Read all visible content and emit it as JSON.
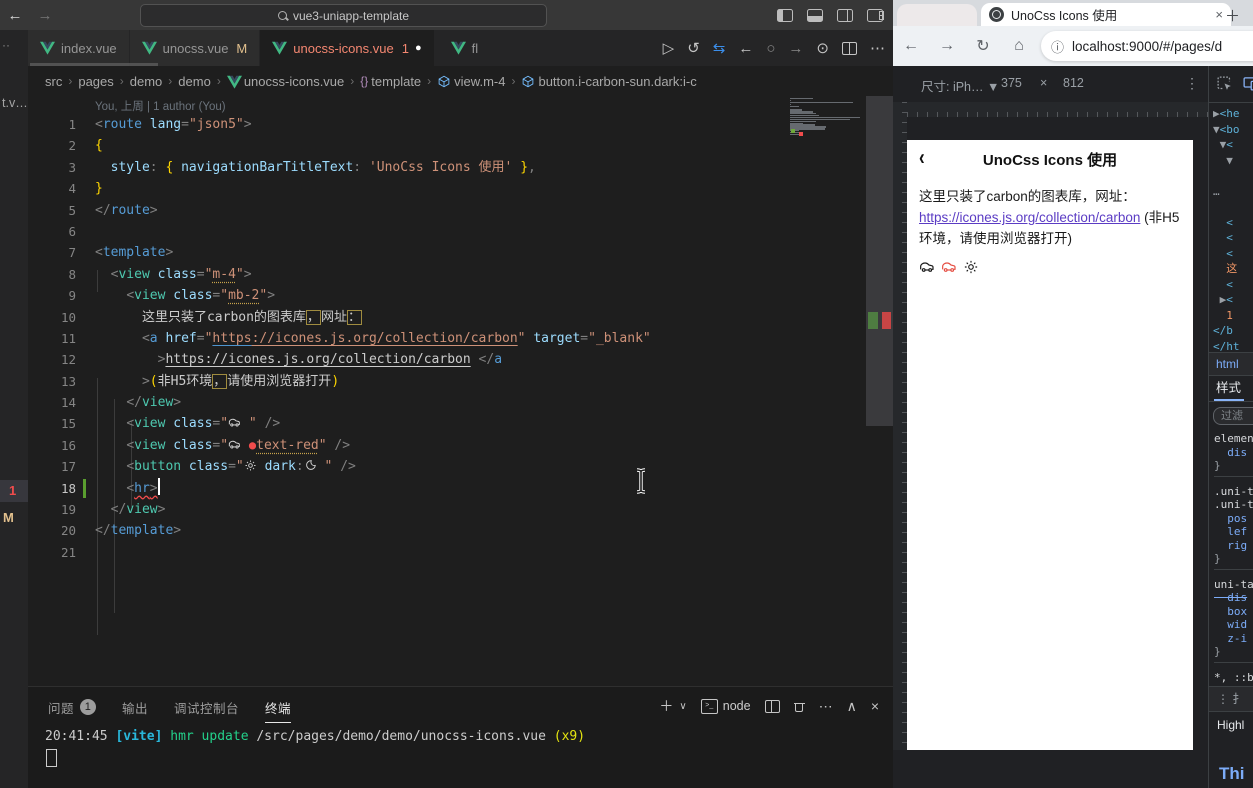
{
  "colors": {
    "vue_green": "#41b883",
    "error_red": "#f14c4c",
    "modified_gold": "#e2c08d",
    "tab_red": "#f48771",
    "accent_blue": "#569cd6",
    "string_orange": "#ce9178",
    "link_purple": "#5b3cc4",
    "devtools_blue": "#8ab4f8"
  },
  "vscode": {
    "titlebar": {
      "search": "vue3-uniapp-template"
    },
    "window_icons": [
      "panel-left",
      "panel-bottom",
      "panel-right",
      "customize-layout"
    ],
    "left_strip": {
      "overflow": "··",
      "file": "t.v…",
      "badge_error": "1",
      "badge_modified": "M"
    },
    "tabs": [
      {
        "label": "index.vue",
        "cls": ""
      },
      {
        "label": "unocss.vue",
        "badge": "M",
        "cls": "t-gold"
      },
      {
        "label": "unocss-icons.vue",
        "badge": "1",
        "dot": "●",
        "cls": "t-red",
        "active": true
      },
      {
        "label": "fl",
        "cls": "",
        "stub": true
      }
    ],
    "editor_actions": [
      {
        "g": "▷",
        "c": ""
      },
      {
        "g": "↺",
        "c": ""
      },
      {
        "g": "⇆",
        "c": "#3b8eea"
      },
      {
        "g": "←",
        "c": ""
      },
      {
        "g": "○",
        "c": "#8a8a8a"
      },
      {
        "g": "→",
        "c": "#8a8a8a"
      },
      {
        "g": "⊙",
        "c": ""
      },
      {
        "g": "SPLIT",
        "c": ""
      },
      {
        "g": "⋯",
        "c": ""
      }
    ],
    "breadcrumb": [
      {
        "t": "src"
      },
      {
        "t": "pages"
      },
      {
        "t": "demo"
      },
      {
        "t": "demo"
      },
      {
        "t": "unocss-icons.vue",
        "ic": "vue"
      },
      {
        "t": "template",
        "ic": "braces"
      },
      {
        "t": "view.m-4",
        "ic": "cube"
      },
      {
        "t": "button.i-carbon-sun.dark:i-c",
        "ic": "cube"
      }
    ],
    "blame": "You, 上周 | 1 author (You)",
    "lines": [
      {
        "n": 1,
        "s": [
          [
            "p",
            "<"
          ],
          [
            "tag",
            "route"
          ],
          [
            "attr",
            " lang"
          ],
          [
            "p",
            "="
          ],
          [
            "str",
            "\"json5\""
          ],
          [
            "p",
            ">"
          ]
        ]
      },
      {
        "n": 2,
        "s": [
          [
            "br",
            "{"
          ]
        ]
      },
      {
        "n": 3,
        "s": [
          [
            "txt",
            "  "
          ],
          [
            "key",
            "style"
          ],
          [
            "p",
            ":"
          ],
          [
            "txt",
            " "
          ],
          [
            "br",
            "{"
          ],
          [
            "txt",
            " "
          ],
          [
            "key",
            "navigationBarTitleText"
          ],
          [
            "p",
            ":"
          ],
          [
            "txt",
            " "
          ],
          [
            "str",
            "'UnoCss Icons 使用'"
          ],
          [
            "txt",
            " "
          ],
          [
            "br",
            "}"
          ],
          [
            "p",
            ","
          ]
        ]
      },
      {
        "n": 4,
        "s": [
          [
            "br",
            "}"
          ]
        ]
      },
      {
        "n": 5,
        "s": [
          [
            "p",
            "</"
          ],
          [
            "tag",
            "route"
          ],
          [
            "p",
            ">"
          ]
        ]
      },
      {
        "n": 6,
        "s": []
      },
      {
        "n": 7,
        "s": [
          [
            "p",
            "<"
          ],
          [
            "tag",
            "template"
          ],
          [
            "p",
            ">"
          ]
        ]
      },
      {
        "n": 8,
        "s": [
          [
            "txt",
            "  "
          ],
          [
            "p",
            "<"
          ],
          [
            "cmp",
            "view"
          ],
          [
            "attr",
            " class"
          ],
          [
            "p",
            "="
          ],
          [
            "str",
            "\""
          ],
          [
            "stru",
            "m-4"
          ],
          [
            "str",
            "\""
          ],
          [
            "p",
            ">"
          ]
        ]
      },
      {
        "n": 9,
        "s": [
          [
            "txt",
            "    "
          ],
          [
            "p",
            "<"
          ],
          [
            "cmp",
            "view"
          ],
          [
            "attr",
            " class"
          ],
          [
            "p",
            "="
          ],
          [
            "str",
            "\""
          ],
          [
            "stru",
            "mb-2"
          ],
          [
            "str",
            "\""
          ],
          [
            "p",
            ">"
          ]
        ]
      },
      {
        "n": 10,
        "s": [
          [
            "txt",
            "      这里只装了carbon的图表库"
          ],
          [
            "box",
            "，"
          ],
          [
            "txt",
            "网址"
          ],
          [
            "box",
            "："
          ]
        ]
      },
      {
        "n": 11,
        "s": [
          [
            "txt",
            "      "
          ],
          [
            "p",
            "<"
          ],
          [
            "tag",
            "a"
          ],
          [
            "attr",
            " href"
          ],
          [
            "p",
            "="
          ],
          [
            "str",
            "\""
          ],
          [
            "lnkb",
            "https"
          ],
          [
            "lnk",
            "://icones.js.org/collection/carbon"
          ],
          [
            "str",
            "\""
          ],
          [
            "attr",
            " target"
          ],
          [
            "p",
            "="
          ],
          [
            "str",
            "\"_blank\""
          ]
        ]
      },
      {
        "n": 12,
        "s": [
          [
            "txt",
            "        "
          ],
          [
            "p",
            ">"
          ],
          [
            "lnkw",
            "https://icones.js.org/collection/carbon"
          ],
          [
            "txt",
            " "
          ],
          [
            "p",
            "</"
          ],
          [
            "tag",
            "a"
          ]
        ]
      },
      {
        "n": 13,
        "s": [
          [
            "txt",
            "      "
          ],
          [
            "p",
            ">"
          ],
          [
            "br",
            "("
          ],
          [
            "txt",
            "非H5环境"
          ],
          [
            "box",
            "，"
          ],
          [
            "txt",
            "请使用浏览器打开"
          ],
          [
            "br",
            ")"
          ]
        ]
      },
      {
        "n": 14,
        "s": [
          [
            "txt",
            "    "
          ],
          [
            "p",
            "</"
          ],
          [
            "cmp",
            "view"
          ],
          [
            "p",
            ">"
          ]
        ]
      },
      {
        "n": 15,
        "s": [
          [
            "txt",
            "    "
          ],
          [
            "p",
            "<"
          ],
          [
            "cmp",
            "view"
          ],
          [
            "attr",
            " class"
          ],
          [
            "p",
            "="
          ],
          [
            "str",
            "\""
          ],
          [
            "car",
            ""
          ],
          [
            "str",
            " \""
          ],
          [
            "txt",
            " "
          ],
          [
            "p",
            "/>"
          ]
        ]
      },
      {
        "n": 16,
        "s": [
          [
            "txt",
            "    "
          ],
          [
            "p",
            "<"
          ],
          [
            "cmp",
            "view"
          ],
          [
            "attr",
            " class"
          ],
          [
            "p",
            "="
          ],
          [
            "str",
            "\""
          ],
          [
            "car",
            ""
          ],
          [
            "str",
            " "
          ],
          [
            "dot",
            "●"
          ],
          [
            "stru",
            "text-red"
          ],
          [
            "str",
            "\""
          ],
          [
            "txt",
            " "
          ],
          [
            "p",
            "/>"
          ]
        ]
      },
      {
        "n": 17,
        "s": [
          [
            "txt",
            "    "
          ],
          [
            "p",
            "<"
          ],
          [
            "cmp",
            "button"
          ],
          [
            "attr",
            " class"
          ],
          [
            "p",
            "="
          ],
          [
            "str",
            "\""
          ],
          [
            "sun",
            ""
          ],
          [
            "str",
            " "
          ],
          [
            "key",
            "dark"
          ],
          [
            "p",
            ":"
          ],
          [
            "moon",
            ""
          ],
          [
            "str",
            " \""
          ],
          [
            "txt",
            " "
          ],
          [
            "p",
            "/>"
          ]
        ]
      },
      {
        "n": 18,
        "s": [
          [
            "txt",
            "    "
          ],
          [
            "p",
            "<"
          ],
          [
            "errt",
            "hr"
          ],
          [
            "errp",
            ">"
          ],
          [
            "caret",
            ""
          ]
        ],
        "mod": true
      },
      {
        "n": 19,
        "s": [
          [
            "txt",
            "  "
          ],
          [
            "p",
            "</"
          ],
          [
            "cmp",
            "view"
          ],
          [
            "p",
            ">"
          ]
        ]
      },
      {
        "n": 20,
        "s": [
          [
            "p",
            "</"
          ],
          [
            "tag",
            "template"
          ],
          [
            "p",
            ">"
          ]
        ]
      },
      {
        "n": 21,
        "s": []
      }
    ],
    "panel": {
      "tabs": [
        {
          "t": "问题",
          "badge": "1"
        },
        {
          "t": "输出"
        },
        {
          "t": "调试控制台"
        },
        {
          "t": "终端",
          "active": true
        }
      ],
      "plus": "＋",
      "chev": "∨",
      "node_label": "node",
      "collapse": "∧",
      "close": "×",
      "more": "⋯",
      "terminal": [
        [
          "w",
          "20:41:45 "
        ],
        [
          "cy",
          "[vite]"
        ],
        [
          "w",
          " "
        ],
        [
          "gr",
          "hmr update"
        ],
        [
          "w",
          " /src/pages/demo/demo/unocss-icons.vue "
        ],
        [
          "ye",
          "(x9)"
        ]
      ]
    }
  },
  "chrome": {
    "tab": {
      "title": "UnoCss Icons 使用",
      "close": "×",
      "new": "＋"
    },
    "toolbar": {
      "back": "←",
      "forward": "→",
      "reload": "↻",
      "home": "⌂",
      "info": "ⓘ",
      "url": "localhost:9000/#/pages/d"
    },
    "device": {
      "label": "尺寸: iPh… ▼",
      "w": "375",
      "x": "×",
      "h": "812",
      "menu": "⋮"
    },
    "page": {
      "back": "‹",
      "title": "UnoCss Icons 使用",
      "p1": "这里只装了carbon的图表库，网址：",
      "link": "https://icones.js.org/collection/carbon",
      "after_link": " (非H5",
      "p3": "环境，请使用浏览器打开)",
      "icons": [
        {
          "type": "car",
          "color": "#1a1a1a"
        },
        {
          "type": "car",
          "color": "#e54d42"
        },
        {
          "type": "sun",
          "color": "#1a1a1a"
        }
      ]
    },
    "devtools": {
      "tree": [
        [
          [
            "g",
            "▶"
          ],
          [
            "b",
            "<he"
          ]
        ],
        [
          [
            "g",
            "▼"
          ],
          [
            "b",
            "<bo"
          ]
        ],
        [
          [
            "w",
            " "
          ],
          [
            "g",
            "▼"
          ],
          [
            "b",
            "<"
          ]
        ],
        [
          [
            "w",
            "  "
          ],
          [
            "g",
            "▼"
          ]
        ],
        [],
        [
          [
            "g",
            "…"
          ]
        ],
        [],
        [
          [
            "w",
            "  "
          ],
          [
            "b",
            "<"
          ]
        ],
        [
          [
            "w",
            "  "
          ],
          [
            "b",
            "<"
          ]
        ],
        [
          [
            "w",
            "  "
          ],
          [
            "b",
            "<"
          ]
        ],
        [
          [
            "w",
            "  "
          ],
          [
            "o",
            "这"
          ]
        ],
        [
          [
            "w",
            "  "
          ],
          [
            "b",
            "<"
          ]
        ],
        [
          [
            "w",
            " "
          ],
          [
            "g",
            "▶"
          ],
          [
            "b",
            "<"
          ]
        ],
        [
          [
            "w",
            "  "
          ],
          [
            "o",
            "1"
          ]
        ],
        [
          [
            "b",
            "</b"
          ]
        ],
        [
          [
            "b",
            "</ht"
          ]
        ]
      ],
      "crumb": "html",
      "style_tab": "样式",
      "filter": "过滤",
      "styles": [
        [
          "sel",
          "elemen"
        ],
        [
          "pr",
          "  dis"
        ],
        [
          "cb",
          "}"
        ],
        [
          "gap",
          ""
        ],
        [
          "sel",
          ".uni-t"
        ],
        [
          "sel",
          ".uni-t"
        ],
        [
          "pr",
          "  pos"
        ],
        [
          "pr",
          "  lef"
        ],
        [
          "pr",
          "  rig"
        ],
        [
          "cb",
          "}"
        ],
        [
          "gap",
          ""
        ],
        [
          "sel",
          "uni-ta"
        ],
        [
          "prs",
          "  dis"
        ],
        [
          "pr",
          "  box"
        ],
        [
          "pr",
          "  wid"
        ],
        [
          "pr",
          "  z-i"
        ],
        [
          "cb",
          "}"
        ],
        [
          "gap",
          ""
        ],
        [
          "sel",
          "*, ::b"
        ]
      ],
      "foot_menu": "⋮  扌",
      "foot1": "Highl",
      "foot2": "Thi"
    }
  }
}
